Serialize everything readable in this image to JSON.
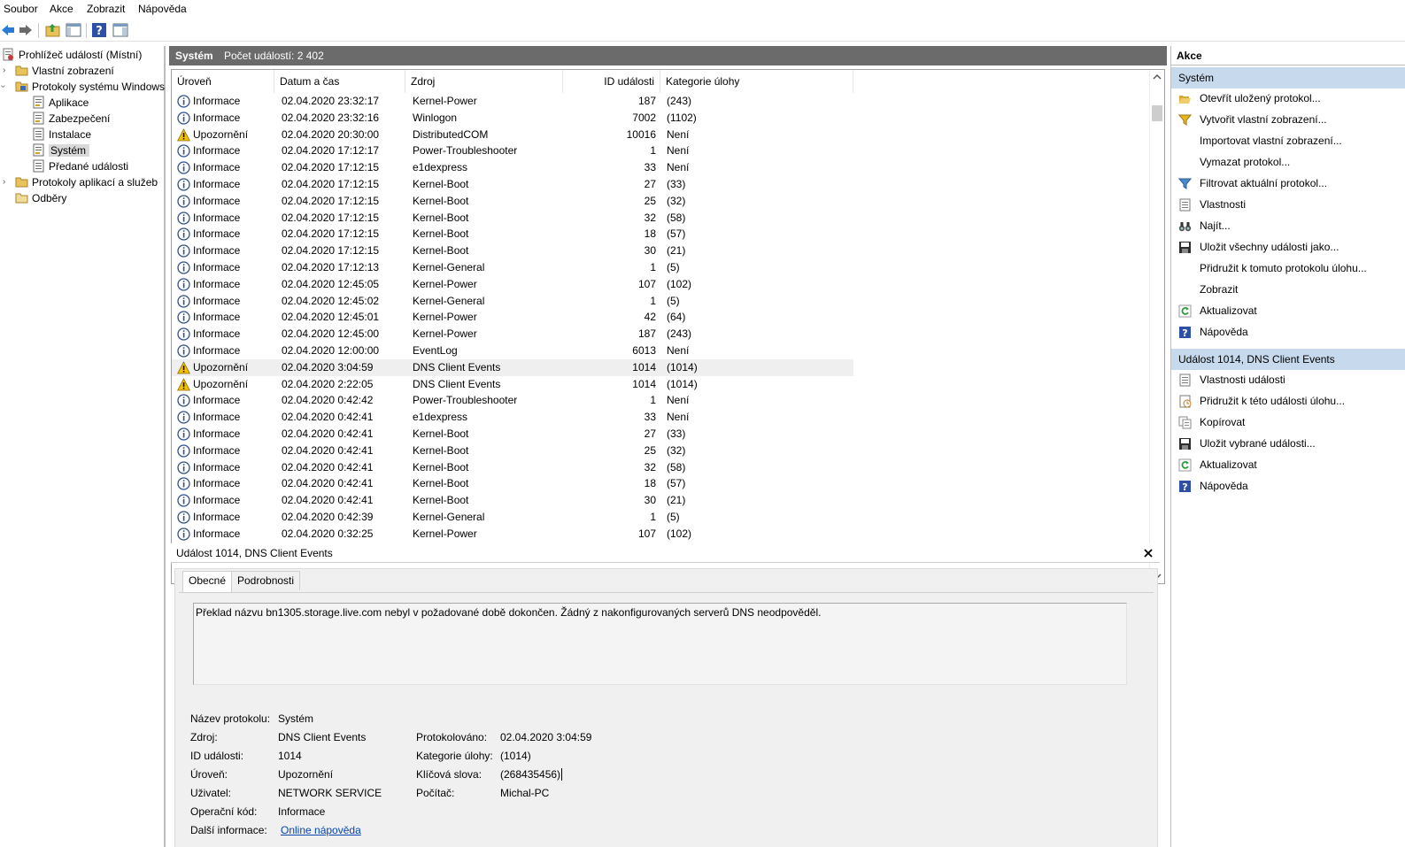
{
  "menu": [
    "Soubor",
    "Akce",
    "Zobrazit",
    "Nápověda"
  ],
  "toolbar": {
    "icons": [
      "back-arrow-icon",
      "forward-arrow-icon",
      "up-folder-icon",
      "show-hide-tree-icon",
      "help-icon",
      "show-hide-action-pane-icon"
    ]
  },
  "tree": {
    "root": "Prohlížeč událostí (Místní)",
    "custom_views": "Vlastní zobrazení",
    "windows_logs": "Protokoly systému Windows",
    "application": "Aplikace",
    "security": "Zabezpečení",
    "setup": "Instalace",
    "system": "Systém",
    "forwarded": "Předané události",
    "app_service_logs": "Protokoly aplikací a služeb",
    "subscriptions": "Odběry"
  },
  "center": {
    "title": "Systém",
    "count": "Počet událostí: 2 402"
  },
  "columns": {
    "level": "Úroveň",
    "datetime": "Datum a čas",
    "source": "Zdroj",
    "event_id": "ID události",
    "category": "Kategorie úlohy"
  },
  "events": [
    {
      "level": "Informace",
      "icon": "info-icon",
      "datetime": "02.04.2020 23:32:17",
      "source": "Kernel-Power",
      "id": "187",
      "category": "(243)"
    },
    {
      "level": "Informace",
      "icon": "info-icon",
      "datetime": "02.04.2020 23:32:16",
      "source": "Winlogon",
      "id": "7002",
      "category": "(1102)"
    },
    {
      "level": "Upozornění",
      "icon": "warning-icon",
      "datetime": "02.04.2020 20:30:00",
      "source": "DistributedCOM",
      "id": "10016",
      "category": "Není"
    },
    {
      "level": "Informace",
      "icon": "info-icon",
      "datetime": "02.04.2020 17:12:17",
      "source": "Power-Troubleshooter",
      "id": "1",
      "category": "Není"
    },
    {
      "level": "Informace",
      "icon": "info-icon",
      "datetime": "02.04.2020 17:12:15",
      "source": "e1dexpress",
      "id": "33",
      "category": "Není"
    },
    {
      "level": "Informace",
      "icon": "info-icon",
      "datetime": "02.04.2020 17:12:15",
      "source": "Kernel-Boot",
      "id": "27",
      "category": "(33)"
    },
    {
      "level": "Informace",
      "icon": "info-icon",
      "datetime": "02.04.2020 17:12:15",
      "source": "Kernel-Boot",
      "id": "25",
      "category": "(32)"
    },
    {
      "level": "Informace",
      "icon": "info-icon",
      "datetime": "02.04.2020 17:12:15",
      "source": "Kernel-Boot",
      "id": "32",
      "category": "(58)"
    },
    {
      "level": "Informace",
      "icon": "info-icon",
      "datetime": "02.04.2020 17:12:15",
      "source": "Kernel-Boot",
      "id": "18",
      "category": "(57)"
    },
    {
      "level": "Informace",
      "icon": "info-icon",
      "datetime": "02.04.2020 17:12:15",
      "source": "Kernel-Boot",
      "id": "30",
      "category": "(21)"
    },
    {
      "level": "Informace",
      "icon": "info-icon",
      "datetime": "02.04.2020 17:12:13",
      "source": "Kernel-General",
      "id": "1",
      "category": "(5)"
    },
    {
      "level": "Informace",
      "icon": "info-icon",
      "datetime": "02.04.2020 12:45:05",
      "source": "Kernel-Power",
      "id": "107",
      "category": "(102)"
    },
    {
      "level": "Informace",
      "icon": "info-icon",
      "datetime": "02.04.2020 12:45:02",
      "source": "Kernel-General",
      "id": "1",
      "category": "(5)"
    },
    {
      "level": "Informace",
      "icon": "info-icon",
      "datetime": "02.04.2020 12:45:01",
      "source": "Kernel-Power",
      "id": "42",
      "category": "(64)"
    },
    {
      "level": "Informace",
      "icon": "info-icon",
      "datetime": "02.04.2020 12:45:00",
      "source": "Kernel-Power",
      "id": "187",
      "category": "(243)"
    },
    {
      "level": "Informace",
      "icon": "info-icon",
      "datetime": "02.04.2020 12:00:00",
      "source": "EventLog",
      "id": "6013",
      "category": "Není"
    },
    {
      "level": "Upozornění",
      "icon": "warning-icon",
      "datetime": "02.04.2020 3:04:59",
      "source": "DNS Client Events",
      "id": "1014",
      "category": "(1014)",
      "selected": true
    },
    {
      "level": "Upozornění",
      "icon": "warning-icon",
      "datetime": "02.04.2020 2:22:05",
      "source": "DNS Client Events",
      "id": "1014",
      "category": "(1014)"
    },
    {
      "level": "Informace",
      "icon": "info-icon",
      "datetime": "02.04.2020 0:42:42",
      "source": "Power-Troubleshooter",
      "id": "1",
      "category": "Není"
    },
    {
      "level": "Informace",
      "icon": "info-icon",
      "datetime": "02.04.2020 0:42:41",
      "source": "e1dexpress",
      "id": "33",
      "category": "Není"
    },
    {
      "level": "Informace",
      "icon": "info-icon",
      "datetime": "02.04.2020 0:42:41",
      "source": "Kernel-Boot",
      "id": "27",
      "category": "(33)"
    },
    {
      "level": "Informace",
      "icon": "info-icon",
      "datetime": "02.04.2020 0:42:41",
      "source": "Kernel-Boot",
      "id": "25",
      "category": "(32)"
    },
    {
      "level": "Informace",
      "icon": "info-icon",
      "datetime": "02.04.2020 0:42:41",
      "source": "Kernel-Boot",
      "id": "32",
      "category": "(58)"
    },
    {
      "level": "Informace",
      "icon": "info-icon",
      "datetime": "02.04.2020 0:42:41",
      "source": "Kernel-Boot",
      "id": "18",
      "category": "(57)"
    },
    {
      "level": "Informace",
      "icon": "info-icon",
      "datetime": "02.04.2020 0:42:41",
      "source": "Kernel-Boot",
      "id": "30",
      "category": "(21)"
    },
    {
      "level": "Informace",
      "icon": "info-icon",
      "datetime": "02.04.2020 0:42:39",
      "source": "Kernel-General",
      "id": "1",
      "category": "(5)"
    },
    {
      "level": "Informace",
      "icon": "info-icon",
      "datetime": "02.04.2020 0:32:25",
      "source": "Kernel-Power",
      "id": "107",
      "category": "(102)"
    }
  ],
  "detail": {
    "title": "Událost 1014, DNS Client Events",
    "tab_general": "Obecné",
    "tab_details": "Podrobnosti",
    "message": "Překlad názvu bn1305.storage.live.com nebyl v požadované době dokončen. Žádný z nakonfigurovaných serverů DNS neodpověděl.",
    "labels": {
      "log_name": "Název protokolu:",
      "source": "Zdroj:",
      "event_id": "ID události:",
      "level": "Úroveň:",
      "user": "Uživatel:",
      "opcode": "Operační kód:",
      "more_info": "Další informace:",
      "logged": "Protokolováno:",
      "task_category": "Kategorie úlohy:",
      "keywords": "Klíčová slova:",
      "computer": "Počítač:"
    },
    "values": {
      "log_name": "Systém",
      "source": "DNS Client Events",
      "event_id": "1014",
      "level": "Upozornění",
      "user": "NETWORK SERVICE",
      "opcode": "Informace",
      "more_info_link": "Online nápověda",
      "logged": "02.04.2020 3:04:59",
      "task_category": "(1014)",
      "keywords": "(268435456)",
      "computer": "Michal-PC"
    }
  },
  "actions": {
    "header": "Akce",
    "section1": "Systém",
    "section1_items": [
      {
        "label": "Otevřít uložený protokol...",
        "icon": "open-folder-icon"
      },
      {
        "label": "Vytvořit vlastní zobrazení...",
        "icon": "create-view-filter-icon"
      },
      {
        "label": "Importovat vlastní zobrazení...",
        "icon": ""
      },
      {
        "label": "Vymazat protokol...",
        "icon": ""
      },
      {
        "label": "Filtrovat aktuální protokol...",
        "icon": "filter-icon"
      },
      {
        "label": "Vlastnosti",
        "icon": "properties-icon"
      },
      {
        "label": "Najít...",
        "icon": "binoculars-icon"
      },
      {
        "label": "Uložit všechny události jako...",
        "icon": "save-icon"
      },
      {
        "label": "Přidružit k tomuto protokolu úlohu...",
        "icon": ""
      },
      {
        "label": "Zobrazit",
        "icon": ""
      },
      {
        "label": "Aktualizovat",
        "icon": "refresh-icon"
      },
      {
        "label": "Nápověda",
        "icon": "help-icon"
      }
    ],
    "section2": "Událost 1014, DNS Client Events",
    "section2_items": [
      {
        "label": "Vlastnosti události",
        "icon": "event-properties-icon"
      },
      {
        "label": "Přidružit k této události úlohu...",
        "icon": "attach-task-icon"
      },
      {
        "label": "Kopírovat",
        "icon": "copy-icon"
      },
      {
        "label": "Uložit vybrané události...",
        "icon": "save-icon"
      },
      {
        "label": "Aktualizovat",
        "icon": "refresh-icon"
      },
      {
        "label": "Nápověda",
        "icon": "help-icon"
      }
    ]
  },
  "colors": {
    "center_header_bg": "#6b6b6b",
    "action_section_bg": "#c7d9ec",
    "info_icon": "#2f4f8f",
    "warning_icon": "#e8b400",
    "link": "#0645ad"
  }
}
